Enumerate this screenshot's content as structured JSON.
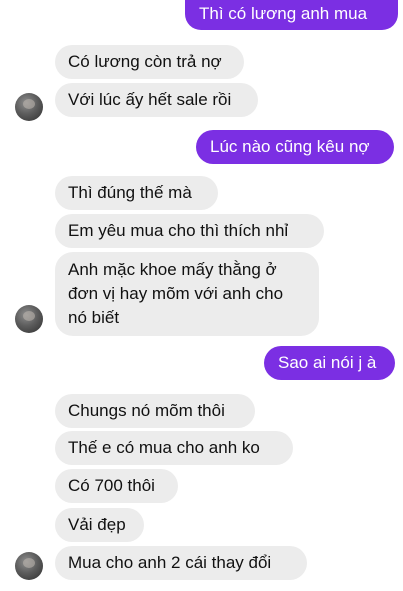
{
  "messages": [
    {
      "side": "out",
      "text": "Thì có lương anh mua"
    },
    {
      "side": "in",
      "text": "Có lương còn trả nợ"
    },
    {
      "side": "in",
      "text": "Với lúc ấy hết sale rồi"
    },
    {
      "side": "out",
      "text": "Lúc nào cũng kêu nợ"
    },
    {
      "side": "in",
      "text": "Thì đúng thế mà"
    },
    {
      "side": "in",
      "text": "Em yêu mua cho thì thích nhỉ"
    },
    {
      "side": "in",
      "text": "Anh mặc khoe mấy thằng ở đơn vị hay mõm với anh cho nó biết"
    },
    {
      "side": "out",
      "text": "Sao ai nói j à"
    },
    {
      "side": "in",
      "text": "Chungs nó mõm thôi"
    },
    {
      "side": "in",
      "text": "Thế  e có mua cho anh ko"
    },
    {
      "side": "in",
      "text": "Có 700 thôi"
    },
    {
      "side": "in",
      "text": "Vải đẹp"
    },
    {
      "side": "in",
      "text": "Mua cho anh 2 cái thay đổi"
    }
  ]
}
